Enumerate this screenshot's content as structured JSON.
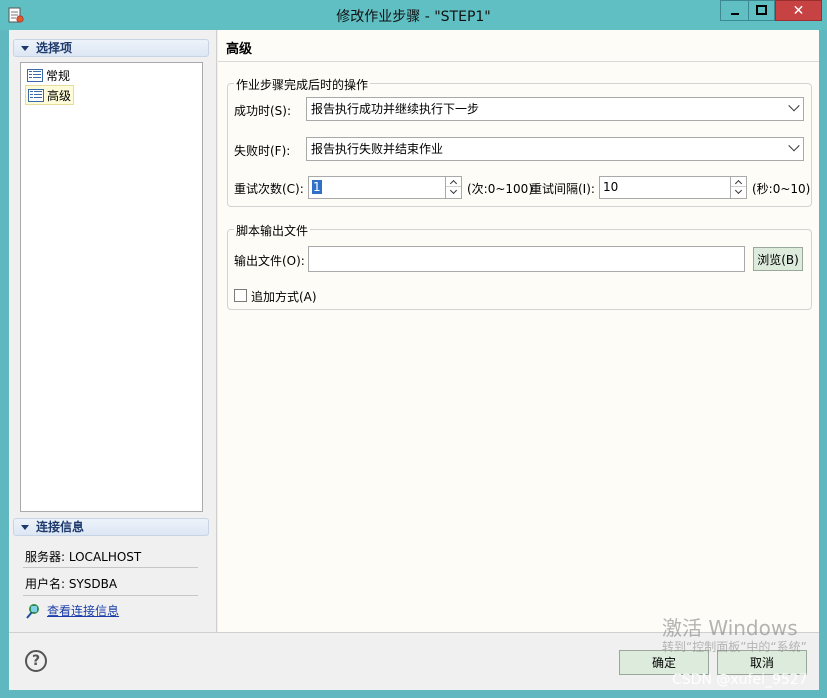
{
  "window": {
    "title": "修改作业步骤 - \"STEP1\"",
    "close_glyph": "✕"
  },
  "left": {
    "select_header": "选择项",
    "tree_items": [
      {
        "label": "常规"
      },
      {
        "label": "高级"
      }
    ],
    "conn_header": "连接信息",
    "server_line": "服务器: LOCALHOST",
    "user_line": "用户名: SYSDBA",
    "view_link": "查看连接信息"
  },
  "right": {
    "title": "高级",
    "after_group": {
      "legend": "作业步骤完成后时的操作",
      "success_label": "成功时(S):",
      "success_value": "报告执行成功并继续执行下一步",
      "fail_label": "失败时(F):",
      "fail_value": "报告执行失败并结束作业",
      "retry_label": "重试次数(C):",
      "retry_value": "1",
      "retry_hint": "(次:0~100)",
      "interval_label": "重试间隔(I):",
      "interval_value": "10",
      "interval_hint": "(秒:0~10)"
    },
    "script_group": {
      "legend": "脚本输出文件",
      "output_label": "输出文件(O):",
      "output_value": "",
      "browse_label": "浏览(B)",
      "append_label": "追加方式(A)",
      "append_checked": false
    }
  },
  "footer": {
    "help_glyph": "?",
    "ok_label": "确定",
    "cancel_label": "取消"
  },
  "watermark": {
    "activate": "激活 Windows",
    "activate_sub": "转到“控制面板”中的“系统”",
    "csdn": "CSDN @xufei_9527"
  }
}
